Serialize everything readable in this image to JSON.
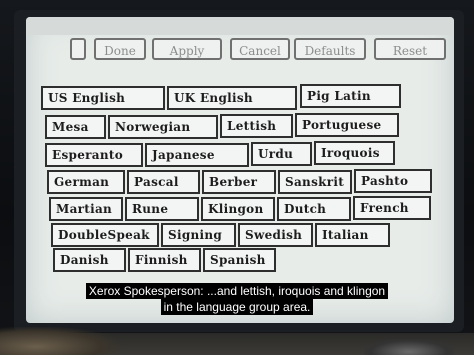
{
  "toolbar": {
    "done": "Done",
    "apply": "Apply",
    "cancel": "Cancel",
    "defaults": "Defaults",
    "reset": "Reset"
  },
  "languages": [
    "US English",
    "UK English",
    "Pig Latin",
    "Mesa",
    "Norwegian",
    "Lettish",
    "Portuguese",
    "Esperanto",
    "Japanese",
    "Urdu",
    "Iroquois",
    "German",
    "Pascal",
    "Berber",
    "Sanskrit",
    "Pashto",
    "Martian",
    "Rune",
    "Klingon",
    "Dutch",
    "French",
    "DoubleSpeak",
    "Signing",
    "Swedish",
    "Italian",
    "Danish",
    "Finnish",
    "Spanish"
  ],
  "caption": {
    "line1": "Xerox Spokesperson: ...and lettish, iroquois and klingon",
    "line2": "in the language group area."
  },
  "colors": {
    "screen_bg": "#e7ece9",
    "button_border": "#2e2e2e",
    "disabled_text": "#8a8d8c"
  }
}
